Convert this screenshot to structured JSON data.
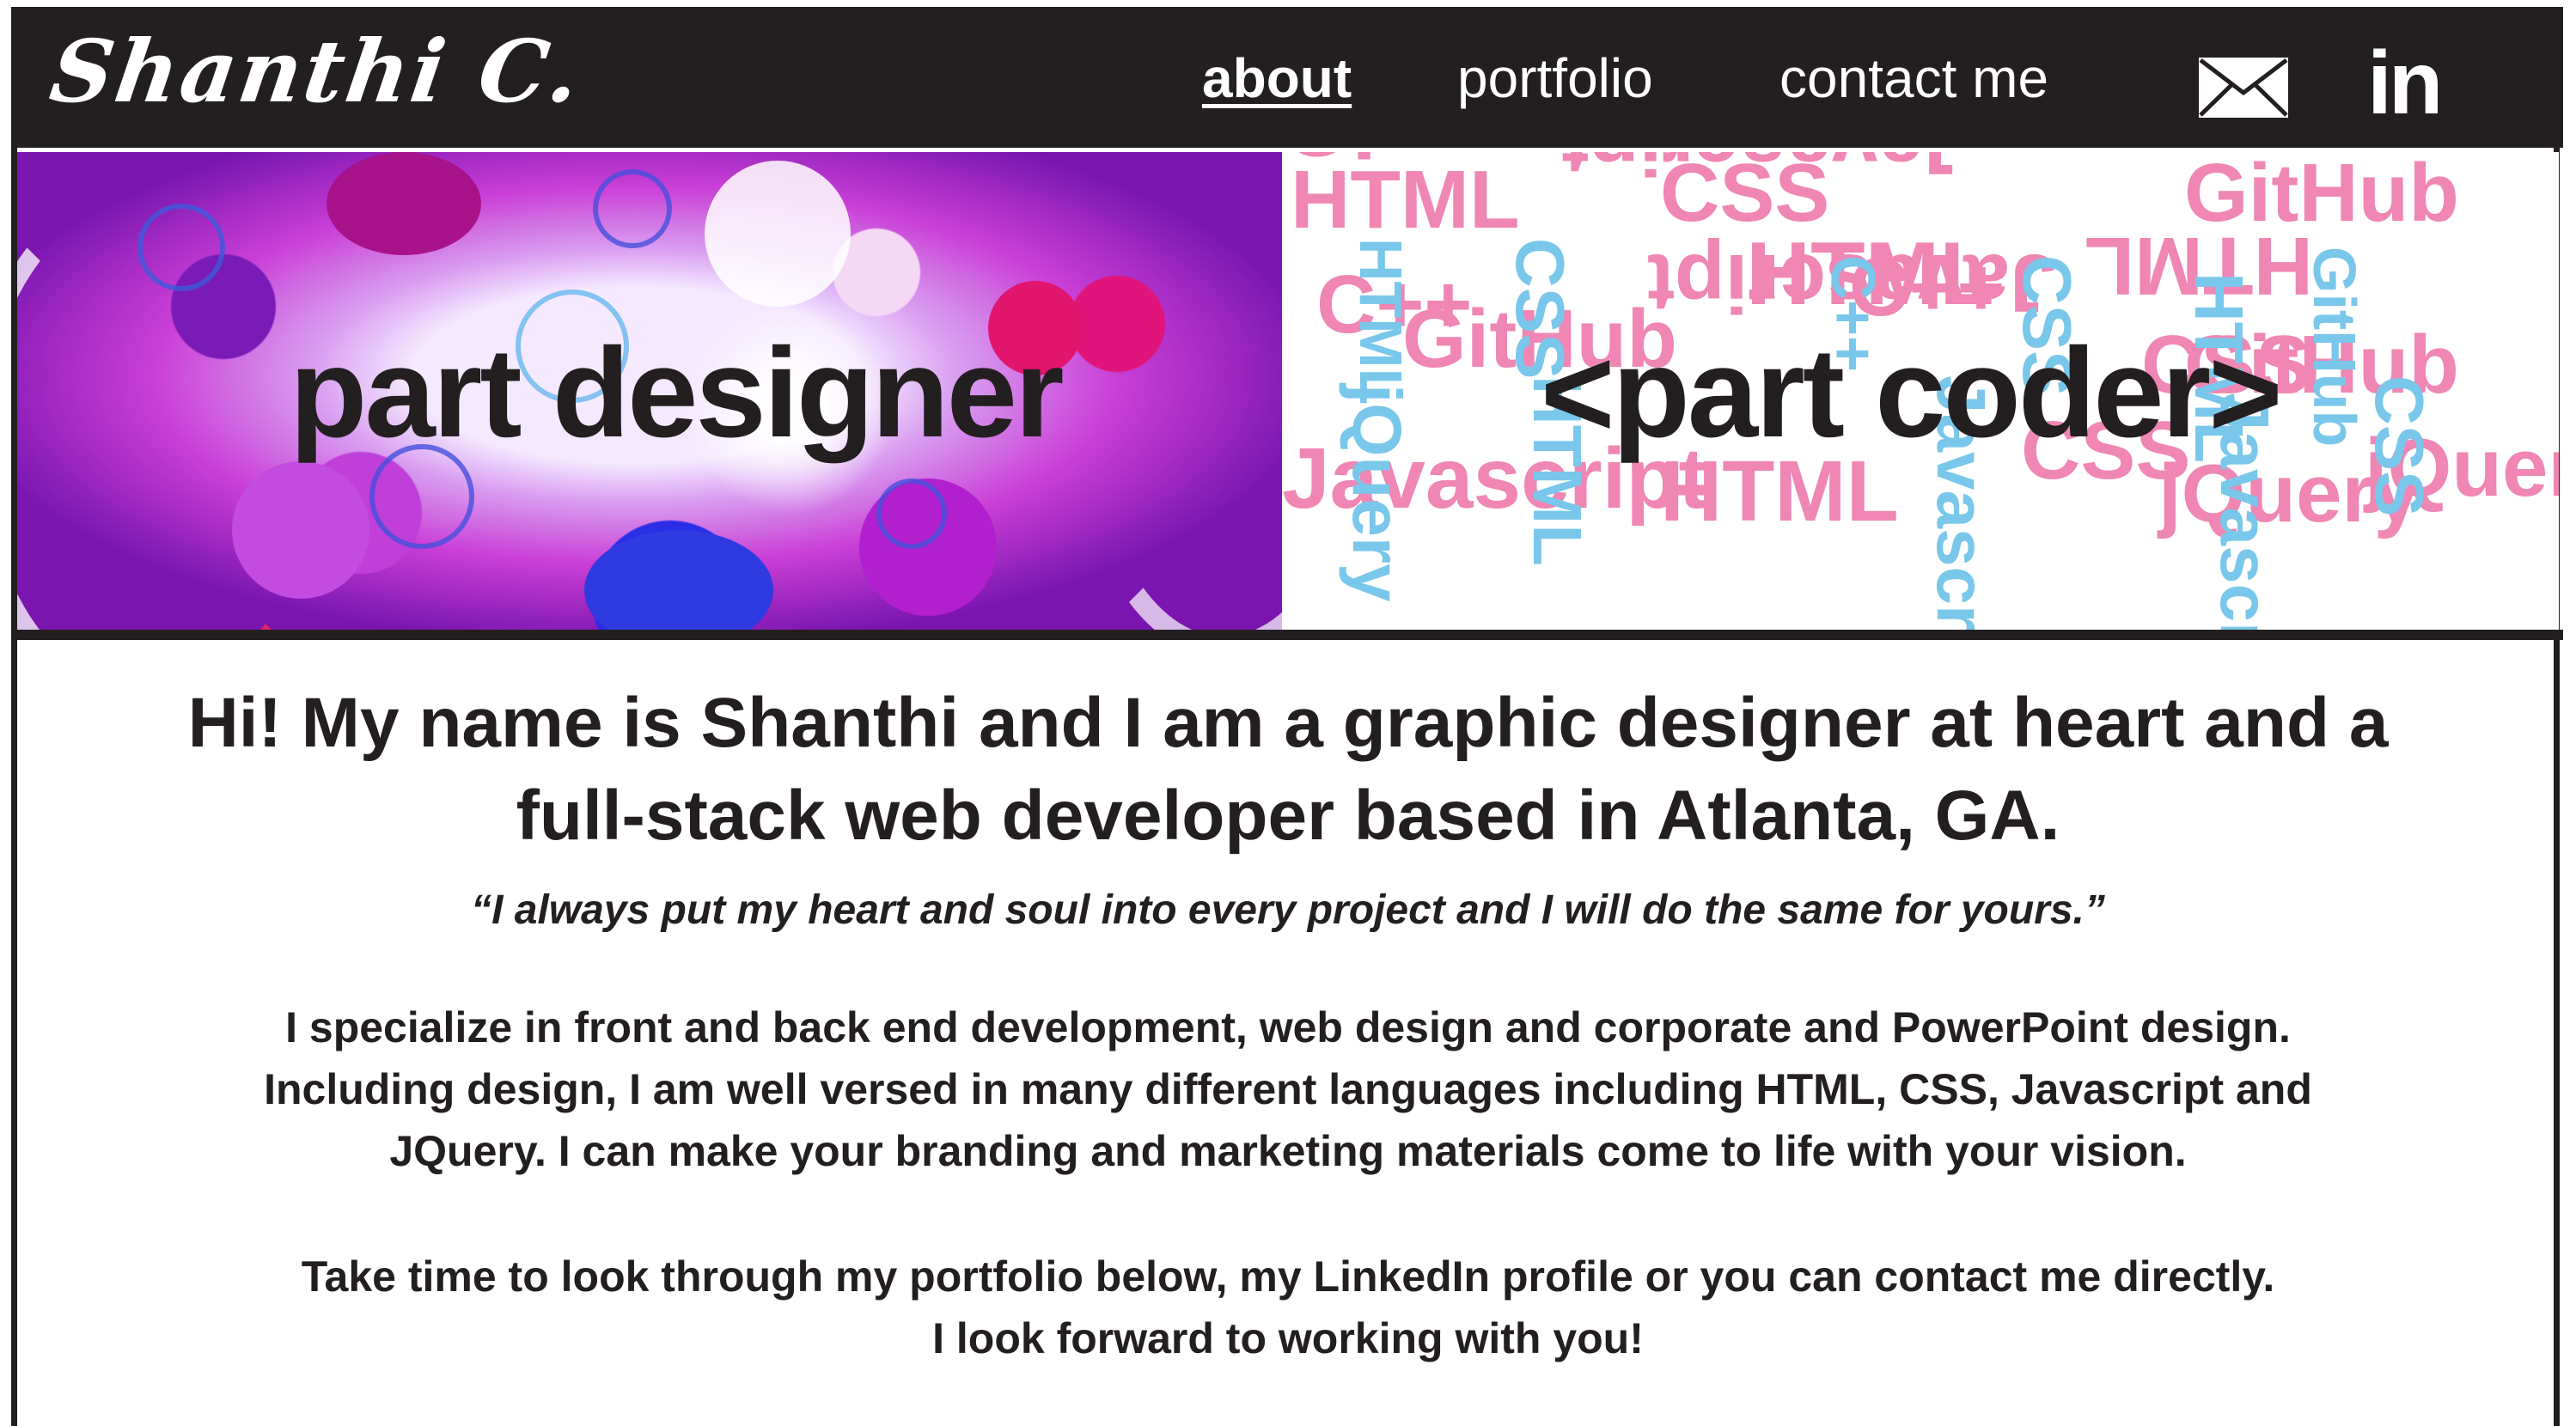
{
  "nav": {
    "logo": "Shanthi C.",
    "links": {
      "about": "about",
      "portfolio": "portfolio",
      "contact": "contact me"
    },
    "active": "about",
    "icons": {
      "mail": "mail-icon",
      "linkedin": "linkedin-icon"
    },
    "linkedin_text": "in"
  },
  "hero": {
    "designer_title": "part designer",
    "coder_title": "<part coder>",
    "code_words": [
      "HTML",
      "jQuery",
      "Javascript",
      "C++",
      "CSS",
      "GitHub",
      "Javascript",
      "HTML",
      "C++",
      "CSS",
      "CSS",
      "HTML",
      "jQuery",
      "GitHub",
      "HTML",
      "jQuery",
      "GitHub",
      "Javascript",
      "HTML",
      "CSS",
      "jQuery",
      "C++",
      "Javascript",
      "CSS",
      "HTML",
      "GitHub",
      "jQuery",
      "HTML",
      "Javascript",
      "CSS"
    ]
  },
  "intro": {
    "heading_line1": "Hi! My name is Shanthi and I am a graphic designer at heart and a",
    "heading_line2": "full-stack web developer based in Atlanta, GA.",
    "quote": "“I always put my heart and soul into every project and I will do the same for yours.”",
    "body_line1": "I specialize in front and back end development, web design and corporate and PowerPoint design.",
    "body_line2": "Including design, I am well versed in many different languages including HTML, CSS, Javascript and",
    "body_line3": "JQuery. I can make your branding and marketing materials come to life with your vision.",
    "cta_line1": "Take time to look through my portfolio below,  my LinkedIn profile or you can contact me directly.",
    "cta_line2": "I look forward to working with you!"
  },
  "colors": {
    "dark": "#231f20",
    "pink": "#ef86b4",
    "blue": "#79c7ea",
    "white": "#ffffff"
  }
}
